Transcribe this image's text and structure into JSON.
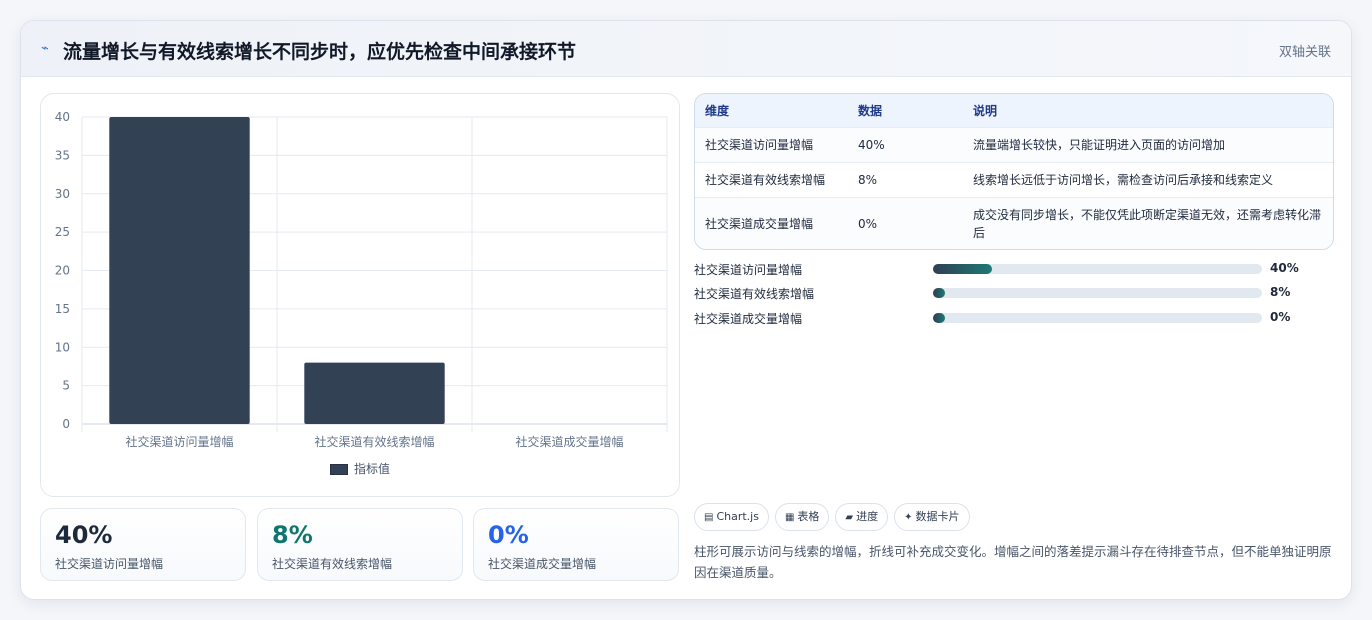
{
  "header": {
    "icon": "trend-icon",
    "title": "流量增长与有效线索增长不同步时，应优先检查中间承接环节",
    "tag": "双轴关联"
  },
  "chart_data": {
    "type": "bar",
    "categories": [
      "社交渠道访问量增幅",
      "社交渠道有效线索增幅",
      "社交渠道成交量增幅"
    ],
    "series": [
      {
        "name": "指标值",
        "values": [
          40,
          8,
          0
        ]
      }
    ],
    "ylim": [
      0,
      40
    ],
    "yticks": [
      0,
      5,
      10,
      15,
      20,
      25,
      30,
      35,
      40
    ],
    "grid": true,
    "legend_position": "bottom",
    "bar_color": "#334155"
  },
  "kpis": [
    {
      "value": "40%",
      "label": "社交渠道访问量增幅",
      "color": "#1e293b"
    },
    {
      "value": "8%",
      "label": "社交渠道有效线索增幅",
      "color": "#0f766e"
    },
    {
      "value": "0%",
      "label": "社交渠道成交量增幅",
      "color": "#2563eb"
    }
  ],
  "table": {
    "headers": [
      "维度",
      "数据",
      "说明"
    ],
    "rows": [
      [
        "社交渠道访问量增幅",
        "40%",
        "流量端增长较快，只能证明进入页面的访问增加"
      ],
      [
        "社交渠道有效线索增幅",
        "8%",
        "线索增长远低于访问增长，需检查访问后承接和线索定义"
      ],
      [
        "社交渠道成交量增幅",
        "0%",
        "成交没有同步增长，不能仅凭此项断定渠道无效，还需考虑转化滞后"
      ]
    ]
  },
  "progress": [
    {
      "label": "社交渠道访问量增幅",
      "value_text": "40%",
      "fraction": 0.18
    },
    {
      "label": "社交渠道有效线索增幅",
      "value_text": "8%",
      "fraction": 0.036
    },
    {
      "label": "社交渠道成交量增幅",
      "value_text": "0%",
      "fraction": 0.0
    }
  ],
  "chips": [
    {
      "icon": "chart-icon",
      "glyph": "▤",
      "label": "Chart.js"
    },
    {
      "icon": "table-icon",
      "glyph": "▦",
      "label": "表格"
    },
    {
      "icon": "progress-icon",
      "glyph": "▰",
      "label": "进度"
    },
    {
      "icon": "card-icon",
      "glyph": "✦",
      "label": "数据卡片"
    }
  ],
  "note": "柱形可展示访问与线索的增幅，折线可补充成交变化。增幅之间的落差提示漏斗存在待排查节点，但不能单独证明原因在渠道质量。"
}
